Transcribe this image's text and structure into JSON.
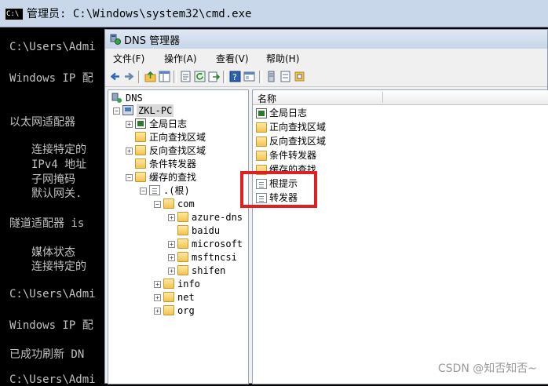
{
  "cmd": {
    "title": "管理员: C:\\Windows\\system32\\cmd.exe",
    "icon_text": "C:\\",
    "lines": [
      "C:\\Users\\Admi",
      "Windows IP 配",
      "以太网适配器",
      "连接特定的",
      "IPv4 地址",
      "子网掩码",
      "默认网关.",
      "隧道适配器 is",
      "媒体状态",
      "连接特定的",
      "C:\\Users\\Admi",
      "Windows IP 配",
      "已成功刷新 DN",
      "C:\\Users\\Admi"
    ]
  },
  "dns": {
    "title": "DNS 管理器",
    "menu": [
      "文件(F)",
      "操作(A)",
      "查看(V)",
      "帮助(H)"
    ],
    "toolbar_icons": [
      "back-icon",
      "forward-icon",
      "up-icon",
      "show-tree-icon",
      "properties-icon",
      "refresh-icon",
      "export-icon",
      "help-icon",
      "console-icon",
      "server-icon",
      "filter-icon",
      "settings-icon"
    ],
    "tree": {
      "root": "DNS",
      "server": "ZKL-PC",
      "global_log": "全局日志",
      "forward_zones": "正向查找区域",
      "reverse_zones": "反向查找区域",
      "conditional_forwarders": "条件转发器",
      "cached_lookups": "缓存的查找",
      "root_node": ".(根)",
      "com": "com",
      "com_children": [
        "azure-dns",
        "baidu",
        "microsoft",
        "msftncsi",
        "shifen"
      ],
      "others": [
        "info",
        "net",
        "org"
      ]
    },
    "list": {
      "column_name": "名称",
      "items": [
        "全局日志",
        "正向查找区域",
        "反向查找区域",
        "条件转发器",
        "缓存的查找",
        "根提示",
        "转发器"
      ]
    }
  },
  "watermark": "CSDN @知否知否~",
  "colors": {
    "highlight": "#e02020",
    "cmd_bg": "#000000",
    "cmd_text": "#c0c0c0"
  }
}
